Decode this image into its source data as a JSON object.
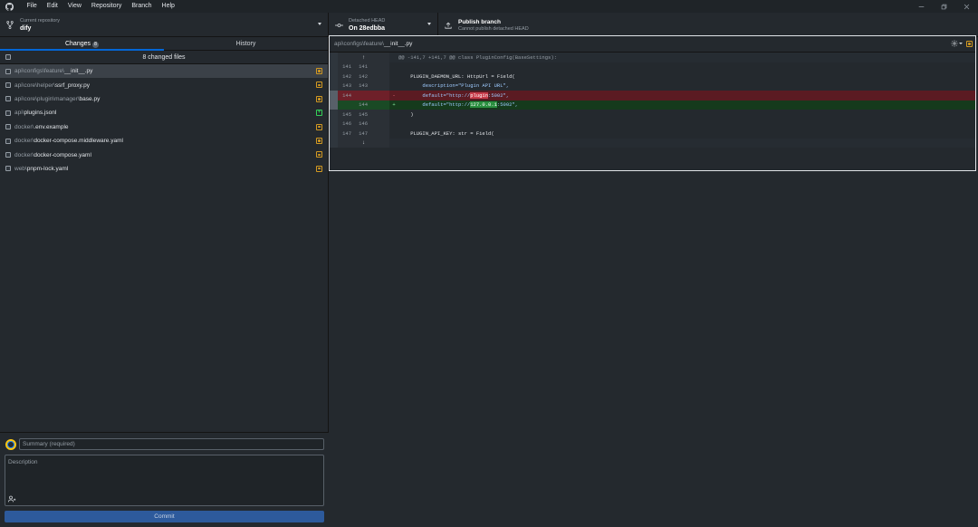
{
  "menu": [
    "File",
    "Edit",
    "View",
    "Repository",
    "Branch",
    "Help"
  ],
  "toolbar": {
    "repo_label": "Current repository",
    "repo_value": "dify",
    "branch_label": "Detached HEAD",
    "branch_value": "On 28edbba",
    "publish_label": "Publish branch",
    "publish_sub": "Cannot publish detached HEAD"
  },
  "tabs": {
    "changes": "Changes",
    "changes_count": "8",
    "history": "History"
  },
  "changed_files_label": "8 changed files",
  "files": [
    {
      "dir": "api\\configs\\feature\\",
      "name": "__init__.py",
      "status": "modified"
    },
    {
      "dir": "api\\core\\helper\\",
      "name": "ssrf_proxy.py",
      "status": "modified"
    },
    {
      "dir": "api\\core\\plugin\\manager\\",
      "name": "base.py",
      "status": "modified"
    },
    {
      "dir": "api\\",
      "name": "plugins.jsonl",
      "status": "new"
    },
    {
      "dir": "docker\\",
      "name": ".env.example",
      "status": "modified"
    },
    {
      "dir": "docker\\",
      "name": "docker-compose.middleware.yaml",
      "status": "modified"
    },
    {
      "dir": "docker\\",
      "name": "docker-compose.yaml",
      "status": "modified"
    },
    {
      "dir": "web\\",
      "name": "pnpm-lock.yaml",
      "status": "modified"
    }
  ],
  "commit": {
    "summary_placeholder": "Summary (required)",
    "description_placeholder": "Description",
    "button_label": "Commit"
  },
  "diff": {
    "file_dir": "api\\configs\\feature\\",
    "file_name": "__init__.py",
    "hunk_header": "@@ -141,7 +141,7 @@ class PluginConfig(BaseSettings):",
    "lines": [
      {
        "old": "141",
        "new": "141",
        "type": "ctx",
        "marker": "",
        "pre": "",
        "hl": "",
        "post": ""
      },
      {
        "old": "142",
        "new": "142",
        "type": "ctx",
        "marker": "",
        "pre": "    PLUGIN_DAEMON_URL: HttpUrl = Field(",
        "hl": "",
        "post": ""
      },
      {
        "old": "143",
        "new": "143",
        "type": "ctx",
        "marker": "",
        "pre": "        description=\"Plugin API URL\",",
        "hl": "",
        "post": ""
      },
      {
        "old": "144",
        "new": "",
        "type": "del",
        "marker": "-",
        "pre": "        default=\"http://",
        "hl": "plugin",
        "post": ":5002\","
      },
      {
        "old": "",
        "new": "144",
        "type": "add",
        "marker": "+",
        "pre": "        default=\"http://",
        "hl": "127.0.0.1",
        "post": ":5002\","
      },
      {
        "old": "145",
        "new": "145",
        "type": "ctx",
        "marker": "",
        "pre": "    )",
        "hl": "",
        "post": ""
      },
      {
        "old": "146",
        "new": "146",
        "type": "ctx",
        "marker": "",
        "pre": "",
        "hl": "",
        "post": ""
      },
      {
        "old": "147",
        "new": "147",
        "type": "ctx",
        "marker": "",
        "pre": "    PLUGIN_API_KEY: str = Field(",
        "hl": "",
        "post": ""
      }
    ]
  },
  "colors": {
    "accent": "#0366d6",
    "modified": "#d29922",
    "added": "#34d058",
    "deleted_bg": "#5b1b22",
    "added_bg": "#153a1c"
  }
}
